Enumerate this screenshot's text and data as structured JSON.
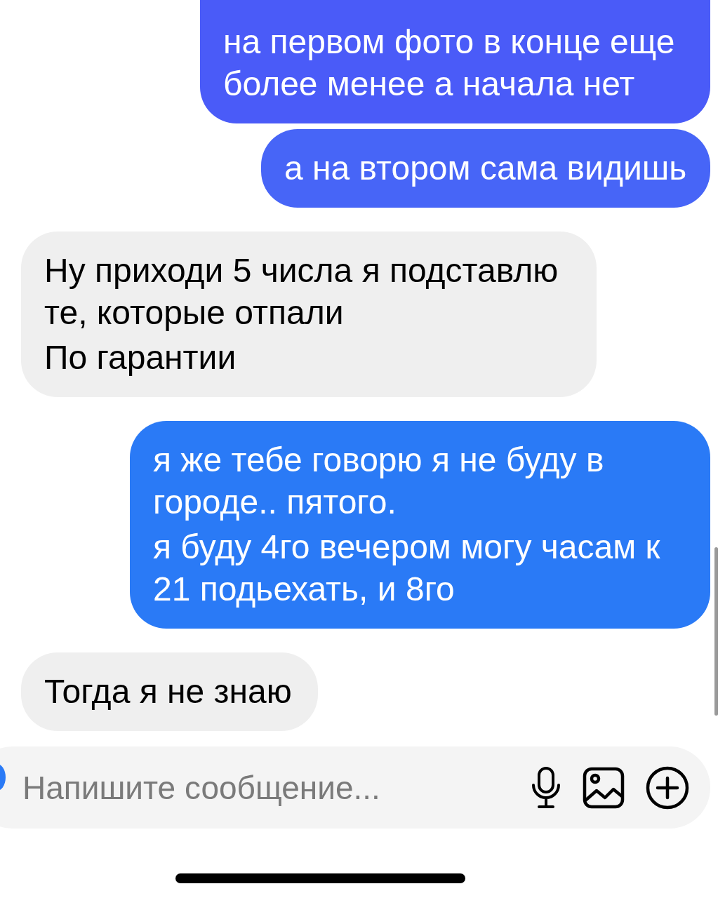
{
  "messages": [
    {
      "kind": "outgoing",
      "color": "#4a5bf8",
      "paragraphs": [
        "на первом фото в конце еще более менее а начала нет"
      ]
    },
    {
      "kind": "outgoing",
      "color": "#4765f7",
      "paragraphs": [
        "а на втором сама видишь"
      ]
    },
    {
      "kind": "incoming",
      "paragraphs": [
        "Ну приходи 5 числа я подставлю те, которые отпали",
        "По гарантии"
      ]
    },
    {
      "kind": "outgoing",
      "color": "#2a7af6",
      "paragraphs": [
        "я же тебе говорю я не буду в городе.. пятого.",
        "я буду 4го вечером могу часам к 21 подьехать, и 8го"
      ]
    },
    {
      "kind": "incoming",
      "paragraphs": [
        "Тогда я не знаю"
      ]
    }
  ],
  "composer": {
    "placeholder": "Напишите сообщение..."
  }
}
